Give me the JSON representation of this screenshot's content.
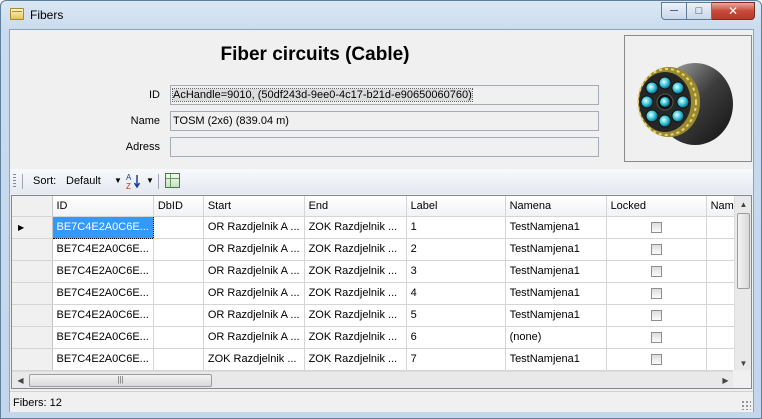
{
  "window": {
    "title": "Fibers"
  },
  "header": {
    "title": "Fiber circuits (Cable)"
  },
  "fields": {
    "id_label": "ID",
    "id_value": "AcHandle=9010, (50df243d-9ee0-4c17-b21d-e90650060760)",
    "name_label": "Name",
    "name_value": "TOSM (2x6) (839.04 m)",
    "adress_label": "Adress",
    "adress_value": ""
  },
  "toolbar": {
    "sort_label": "Sort:",
    "sort_value": "Default"
  },
  "grid": {
    "columns": [
      "ID",
      "DbID",
      "Start",
      "End",
      "Label",
      "Namena",
      "Locked",
      "Name"
    ],
    "rows": [
      {
        "id": "BE7C4E2A0C6E...",
        "dbid": "",
        "start": "OR Razdjelnik A ...",
        "end": "ZOK Razdjelnik ...",
        "label": "1",
        "namena": "TestNamjena1",
        "locked": false
      },
      {
        "id": "BE7C4E2A0C6E...",
        "dbid": "",
        "start": "OR Razdjelnik A ...",
        "end": "ZOK Razdjelnik ...",
        "label": "2",
        "namena": "TestNamjena1",
        "locked": false
      },
      {
        "id": "BE7C4E2A0C6E...",
        "dbid": "",
        "start": "OR Razdjelnik A ...",
        "end": "ZOK Razdjelnik ...",
        "label": "3",
        "namena": "TestNamjena1",
        "locked": false
      },
      {
        "id": "BE7C4E2A0C6E...",
        "dbid": "",
        "start": "OR Razdjelnik A ...",
        "end": "ZOK Razdjelnik ...",
        "label": "4",
        "namena": "TestNamjena1",
        "locked": false
      },
      {
        "id": "BE7C4E2A0C6E...",
        "dbid": "",
        "start": "OR Razdjelnik A ...",
        "end": "ZOK Razdjelnik ...",
        "label": "5",
        "namena": "TestNamjena1",
        "locked": false
      },
      {
        "id": "BE7C4E2A0C6E...",
        "dbid": "",
        "start": "OR Razdjelnik A ...",
        "end": "ZOK Razdjelnik ...",
        "label": "6",
        "namena": "(none)",
        "locked": false
      },
      {
        "id": "BE7C4E2A0C6E...",
        "dbid": "",
        "start": "ZOK Razdjelnik ...",
        "end": "ZOK Razdjelnik ...",
        "label": "7",
        "namena": "TestNamjena1",
        "locked": false
      }
    ]
  },
  "status": {
    "text": "Fibers:  12"
  },
  "colors": {
    "selection": "#3399ff",
    "window_frame": "#c3d6ec"
  },
  "icons": [
    "window-app-icon",
    "minimize-icon",
    "maximize-icon",
    "close-icon",
    "sort-az-icon",
    "grid-settings-icon",
    "cable-cross-section-image",
    "row-pointer-icon",
    "scroll-up-icon",
    "scroll-down-icon",
    "scroll-left-icon",
    "scroll-right-icon",
    "resize-grip-icon"
  ]
}
